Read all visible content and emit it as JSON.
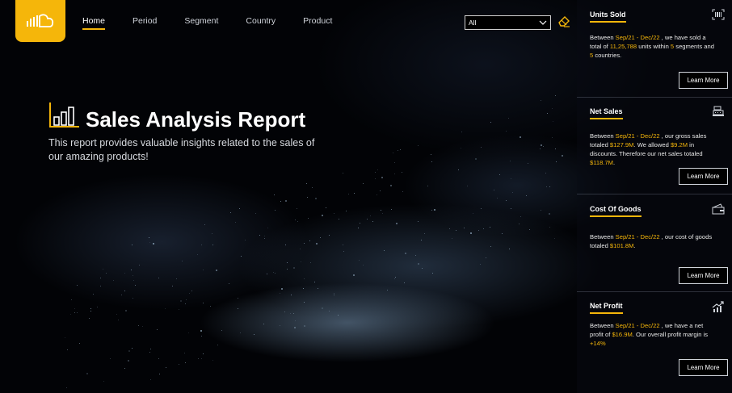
{
  "nav": {
    "items": [
      {
        "label": "Home",
        "active": true
      },
      {
        "label": "Period",
        "active": false
      },
      {
        "label": "Segment",
        "active": false
      },
      {
        "label": "Country",
        "active": false
      },
      {
        "label": "Product",
        "active": false
      }
    ]
  },
  "filter": {
    "selected": "All"
  },
  "hero": {
    "title": "Sales Analysis Report",
    "subtitle": "This report provides valuable insights related to the sales of our amazing products!"
  },
  "cards": {
    "units": {
      "title": "Units Sold",
      "t1": "Between ",
      "period": "Sep/21 - Dec/22",
      "t2": " , we have sold a total of ",
      "units": "11,25,788",
      "t3": " units within ",
      "segments": "5",
      "t4": " segments and ",
      "countries": "5",
      "t5": " countries.",
      "button": "Learn More"
    },
    "net_sales": {
      "title": "Net Sales",
      "t1": "Between ",
      "period": "Sep/21 - Dec/22",
      "t2": " , our gross sales totaled ",
      "gross": "$127.9M",
      "t3": ". We allowed ",
      "discount": "$9.2M",
      "t4": " in discounts. Therefore our net sales totaled ",
      "net": "$118.7M",
      "t5": ".",
      "button": "Learn More"
    },
    "cogs": {
      "title": "Cost Of Goods",
      "t1": "Between ",
      "period": "Sep/21 - Dec/22",
      "t2": " , our cost of goods totaled ",
      "cost": "$101.8M",
      "t3": ".",
      "button": "Learn More"
    },
    "profit": {
      "title": "Net Profit",
      "t1": "Between ",
      "period": "Sep/21 - Dec/22",
      "t2": " , we have a net profit of ",
      "profit": "$16.9M",
      "t3": ". Our overall profit margin is ",
      "margin": "+14%",
      "button": "Learn More"
    }
  },
  "colors": {
    "accent": "#f5b60a",
    "background": "#020306"
  },
  "icons": {
    "logo": "cloud-bars-icon",
    "eraser": "eraser-icon",
    "hero": "bar-chart-icon",
    "units": "barcode-icon",
    "net_sales": "cash-register-icon",
    "cogs": "wallet-icon",
    "profit": "trend-up-icon"
  }
}
